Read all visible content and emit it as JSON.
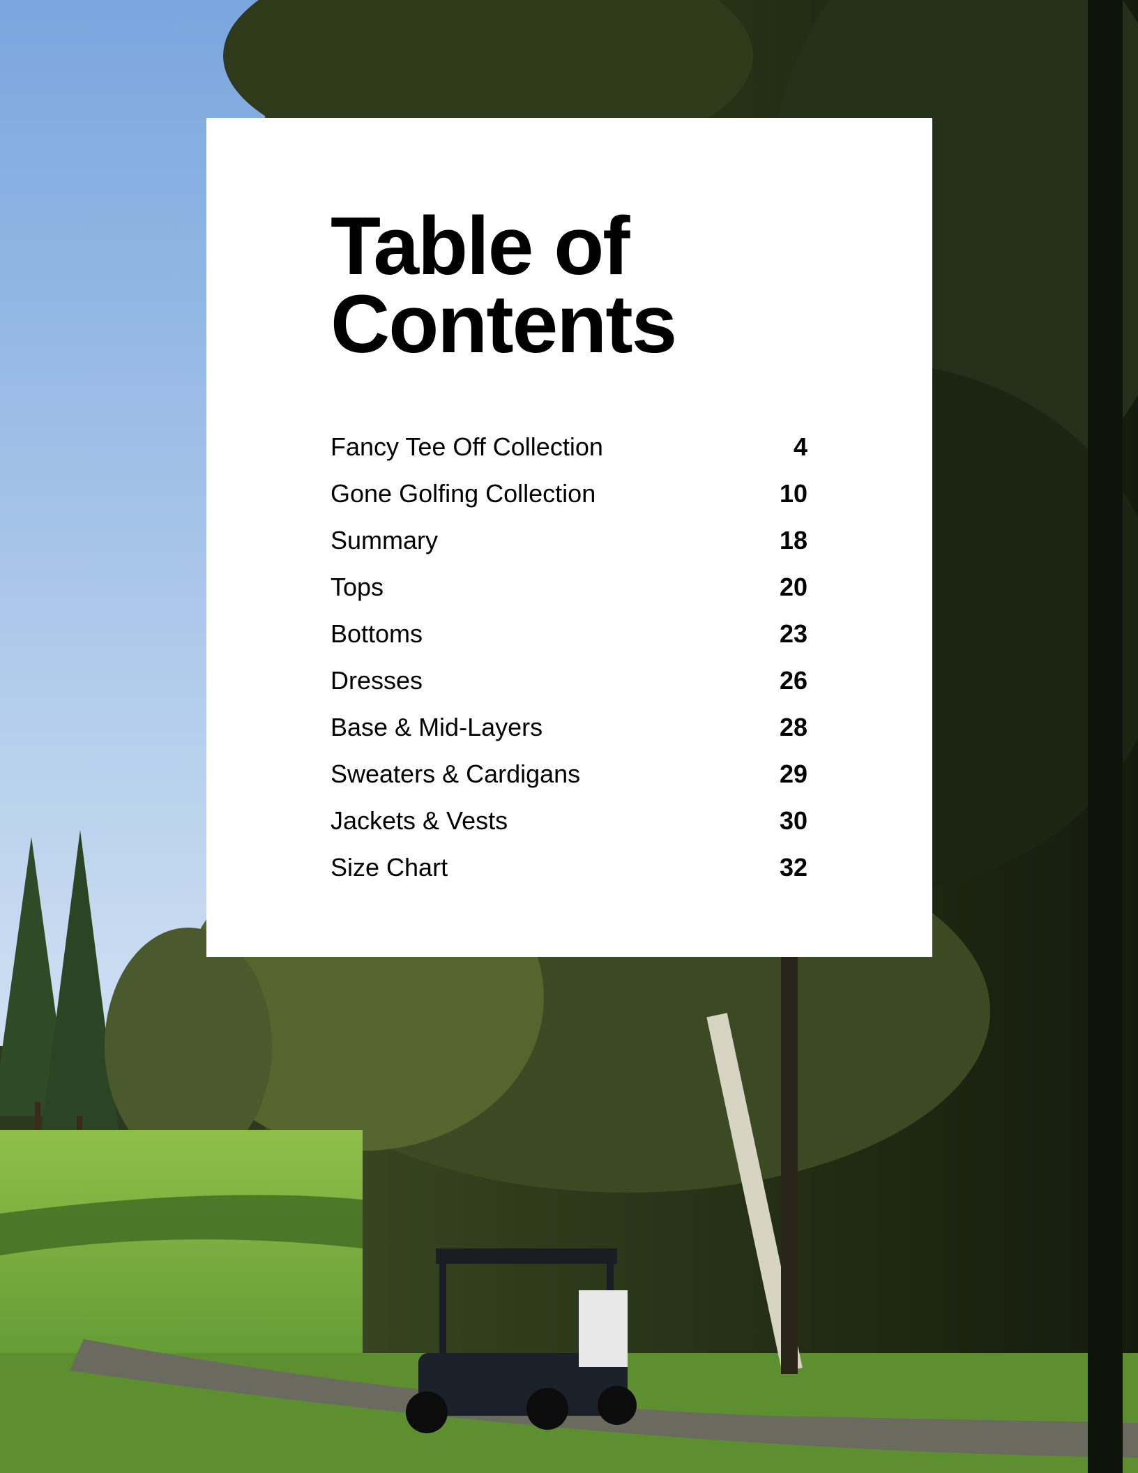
{
  "toc": {
    "title_line1": "Table of",
    "title_line2": "Contents",
    "entries": [
      {
        "label": "Fancy Tee Off Collection",
        "page": "4"
      },
      {
        "label": "Gone Golfing Collection",
        "page": "10"
      },
      {
        "label": "Summary",
        "page": "18"
      },
      {
        "label": "Tops",
        "page": "20"
      },
      {
        "label": "Bottoms",
        "page": "23"
      },
      {
        "label": "Dresses",
        "page": "26"
      },
      {
        "label": "Base & Mid-Layers",
        "page": "28"
      },
      {
        "label": "Sweaters & Cardigans",
        "page": "29"
      },
      {
        "label": "Jackets & Vests",
        "page": "30"
      },
      {
        "label": "Size Chart",
        "page": "32"
      }
    ]
  },
  "colors": {
    "sky": "#8fb8e8",
    "foliage_dark": "#1f2a14",
    "grass": "#6fa53a",
    "card": "#ffffff",
    "text": "#000000"
  }
}
